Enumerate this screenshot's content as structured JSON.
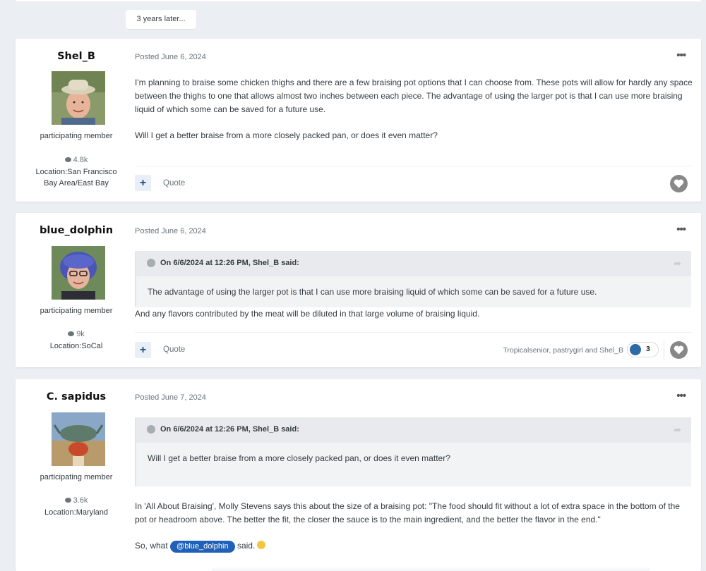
{
  "gap_label": "3 years later...",
  "posts": [
    {
      "username": "Shel_B",
      "role": "participating member",
      "post_count": "4.8k",
      "location": "Location:San Francisco Bay Area/East Bay",
      "posted": "Posted June 6, 2024",
      "paragraphs": [
        "I'm planning to braise some chicken thighs and there are a few braising pot options that I can choose from. These pots will allow for hardly any space between the thighs to one that allows almost two inches between each piece. The advantage of using the larger pot is that I can use more braising liquid of which some can be saved for a future use.",
        "Will I get a better braise from a more closely packed pan, or does it even matter?"
      ],
      "quote_label": "Quote"
    },
    {
      "username": "blue_dolphin",
      "role": "participating member",
      "post_count": "9k",
      "location": "Location:SoCal",
      "posted": "Posted June 6, 2024",
      "quote_header": "On 6/6/2024 at 12:26 PM, Shel_B said:",
      "quote_text": "The advantage of using the larger pot is that I can use more braising liquid of which some can be saved for a future use.",
      "paragraphs": [
        "And any flavors contributed by the meat will be diluted in that large volume of braising liquid."
      ],
      "quote_label": "Quote",
      "reactors": "Tropicalsenior, pastrygirl and Shel_B",
      "reaction_count": "3"
    },
    {
      "username": "C. sapidus",
      "role": "participating member",
      "post_count": "3.6k",
      "location": "Location:Maryland",
      "posted": "Posted June 7, 2024",
      "quote_header": "On 6/6/2024 at 12:26 PM, Shel_B said:",
      "quote_text": "Will I get a better braise from a more closely packed pan, or does it even matter?",
      "paragraphs": [
        "In 'All About Braising', Molly Stevens says this about the size of a braising pot: \"The food should fit without a lot of extra space in the bottom of the pot or headroom above. The better the fit, the closer the sauce is to the main ingredient, and the better the flavor in the end.\""
      ],
      "last_line_prefix": "So, what",
      "mention": "@blue_dolphin",
      "last_line_suffix": "said."
    }
  ],
  "icons": {
    "more": "ellipsis-icon",
    "comment": "speech-bubble-icon",
    "like": "heart-icon",
    "share": "share-arrow-icon",
    "collapse": "chevron-icon",
    "emoji": "smile-emoji"
  },
  "colors": {
    "background": "#ebeef2",
    "mention": "#2160b8",
    "reaction": "#2f6aa6"
  }
}
